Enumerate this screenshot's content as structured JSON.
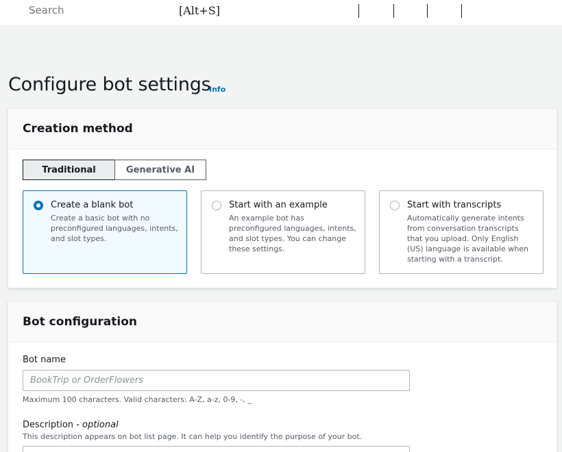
{
  "topbar": {
    "search_placeholder": "Search",
    "search_shortcut": "[Alt+S]"
  },
  "page": {
    "title": "Configure bot settings",
    "info_link": "Info"
  },
  "creation_method": {
    "title": "Creation method",
    "tabs": [
      {
        "label": "Traditional",
        "active": true
      },
      {
        "label": "Generative AI",
        "active": false
      }
    ],
    "options": [
      {
        "title": "Create a blank bot",
        "description": "Create a basic bot with no preconfigured languages, intents, and slot types.",
        "selected": true
      },
      {
        "title": "Start with an example",
        "description": "An example bot has preconfigured languages, intents, and slot types. You can change these settings.",
        "selected": false
      },
      {
        "title": "Start with transcripts",
        "description": "Automatically generate intents from conversation transcripts that you upload. Only English (US) language is available when starting with a transcript.",
        "selected": false
      }
    ]
  },
  "bot_configuration": {
    "title": "Bot configuration",
    "bot_name": {
      "label": "Bot name",
      "placeholder": "BookTrip or OrderFlowers",
      "value": "",
      "constraint": "Maximum 100 characters. Valid characters: A-Z, a-z, 0-9, -, _"
    },
    "description": {
      "label": "Description",
      "optional_label": "- optional",
      "help": "This description appears on bot list page. It can help you identify the purpose of your bot."
    }
  },
  "colors": {
    "accent": "#0073bb",
    "background": "#f2f3f3",
    "selected_tile_bg": "#f1faff"
  }
}
